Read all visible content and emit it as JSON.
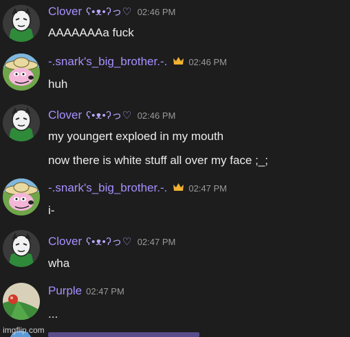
{
  "messages": [
    {
      "author": "Clover",
      "decoration": "ʕ•ᴥ•ʔっ♡",
      "time": "02:46 PM",
      "avatar": "clover-avatar",
      "lines": [
        "AAAAAAAa fuck"
      ]
    },
    {
      "author": "-.snark's_big_brother.-.",
      "crown": true,
      "time": "02:46 PM",
      "avatar": "dog-avatar",
      "lines": [
        "huh"
      ]
    },
    {
      "author": "Clover",
      "decoration": "ʕ•ᴥ•ʔっ♡",
      "time": "02:46 PM",
      "avatar": "clover-avatar",
      "lines": [
        "my youngert exploed in my mouth",
        "now there is white stuff all over my face ;_;"
      ]
    },
    {
      "author": "-.snark's_big_brother.-.",
      "crown": true,
      "time": "02:47 PM",
      "avatar": "dog-avatar",
      "lines": [
        "i-"
      ]
    },
    {
      "author": "Clover",
      "decoration": "ʕ•ᴥ•ʔっ♡",
      "time": "02:47 PM",
      "avatar": "clover-avatar",
      "lines": [
        "wha"
      ]
    },
    {
      "author": "Purple",
      "time": "02:47 PM",
      "avatar": "purple-avatar",
      "lines": [
        "..."
      ]
    }
  ],
  "watermark": "imgflip.com",
  "colors": {
    "background": "#1d1d1d",
    "username": "#a890ff",
    "timestamp": "#9a9a9a",
    "message_text": "#ececec",
    "crown": "#f0b232"
  }
}
